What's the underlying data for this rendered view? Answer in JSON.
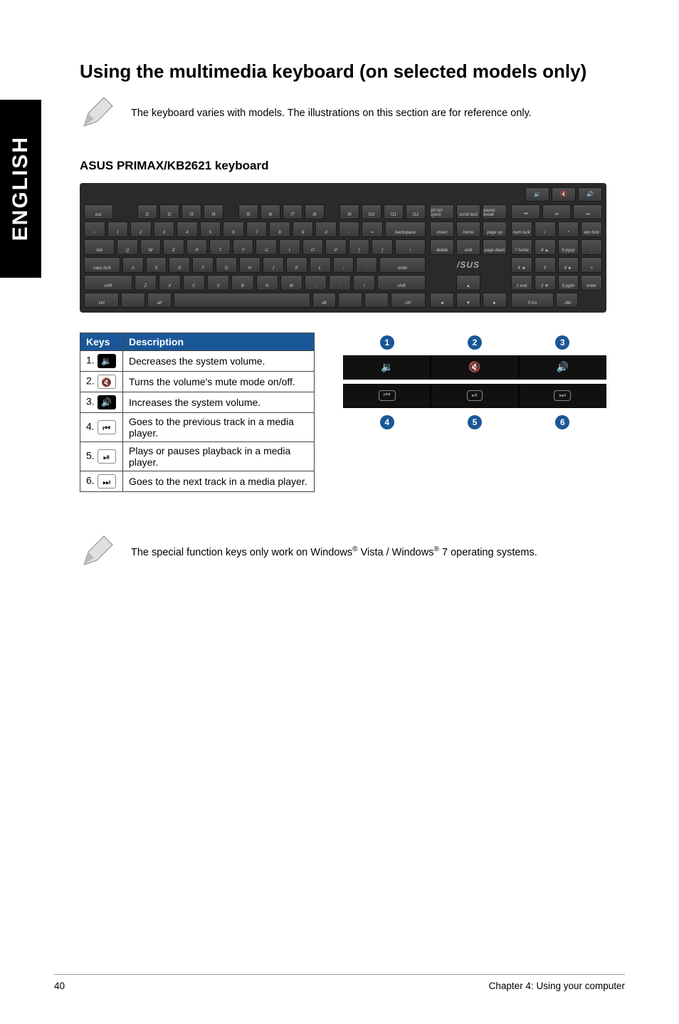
{
  "sideTab": "ENGLISH",
  "heading": "Using the multimedia keyboard (on selected models only)",
  "note1": "The keyboard varies with models. The illustrations on this section are for reference only.",
  "subheading": "ASUS PRIMAX/KB2621 keyboard",
  "table": {
    "head": {
      "keys": "Keys",
      "desc": "Description"
    },
    "rows": [
      {
        "n": "1.",
        "desc": "Decreases the system volume."
      },
      {
        "n": "2.",
        "desc": "Turns the volume's mute mode on/off."
      },
      {
        "n": "3.",
        "desc": "Increases the system volume."
      },
      {
        "n": "4.",
        "desc": "Goes to the previous track in a media player."
      },
      {
        "n": "5.",
        "desc": "Plays or pauses playback in a media player."
      },
      {
        "n": "6.",
        "desc": "Goes to the next track in a media player."
      }
    ]
  },
  "callouts": {
    "c1": "1",
    "c2": "2",
    "c3": "3",
    "c4": "4",
    "c5": "5",
    "c6": "6"
  },
  "icons": {
    "volDown": "🔉",
    "mute": "🔇",
    "volUp": "🔊",
    "prev": "⏮",
    "play": "⏯",
    "next": "⏭"
  },
  "note2_pre": "The special function keys only work on Windows",
  "note2_mid": " Vista / Windows",
  "note2_post": " 7 operating systems.",
  "reg": "®",
  "footer": {
    "page": "40",
    "chapter": "Chapter 4: Using your computer"
  },
  "kb": {
    "asus": "/SUS",
    "frow": [
      "esc",
      "",
      "f1",
      "f2",
      "f3",
      "f4",
      "",
      "f5",
      "f6",
      "f7",
      "f8",
      "",
      "f9",
      "f10",
      "f11",
      "f12"
    ],
    "nrow": [
      "~",
      "1",
      "2",
      "3",
      "4",
      "5",
      "6",
      "7",
      "8",
      "9",
      "0",
      "-",
      "=",
      "backspace"
    ],
    "qrow": [
      "tab",
      "Q",
      "W",
      "E",
      "R",
      "T",
      "Y",
      "U",
      "I",
      "O",
      "P",
      "[",
      "]",
      "\\"
    ],
    "arow": [
      "caps lock",
      "A",
      "S",
      "D",
      "F",
      "G",
      "H",
      "J",
      "K",
      "L",
      ";",
      "'",
      "enter"
    ],
    "zrow": [
      "shift",
      "Z",
      "X",
      "C",
      "V",
      "B",
      "N",
      "M",
      ",",
      ".",
      "/",
      "shift"
    ],
    "brow": [
      "ctrl",
      "",
      "alt",
      "",
      "alt",
      "",
      "",
      "ctrl"
    ],
    "navTop": [
      "prt scr sysrq",
      "scroll lock",
      "pause break"
    ],
    "nav2": [
      "insert",
      "home",
      "page up"
    ],
    "nav3": [
      "delete",
      "end",
      "page down"
    ],
    "navArrows": [
      "◄",
      "▼",
      "►"
    ],
    "navUp": "▲",
    "mediaTop": [
      "🔉",
      "🔇",
      "🔊"
    ],
    "mediaRow2": [
      "⏮",
      "⏯",
      "⏭"
    ],
    "numTop": [
      "num lock",
      "/",
      "*",
      "win lock"
    ],
    "num2": [
      "7 home",
      "8 ▲",
      "9 pgup",
      "-"
    ],
    "num3": [
      "4 ◄",
      "5",
      "6 ►",
      "+"
    ],
    "num4": [
      "1 end",
      "2 ▼",
      "3 pgdn"
    ],
    "num5": [
      "0 ins",
      ". del"
    ],
    "enter": "enter"
  }
}
